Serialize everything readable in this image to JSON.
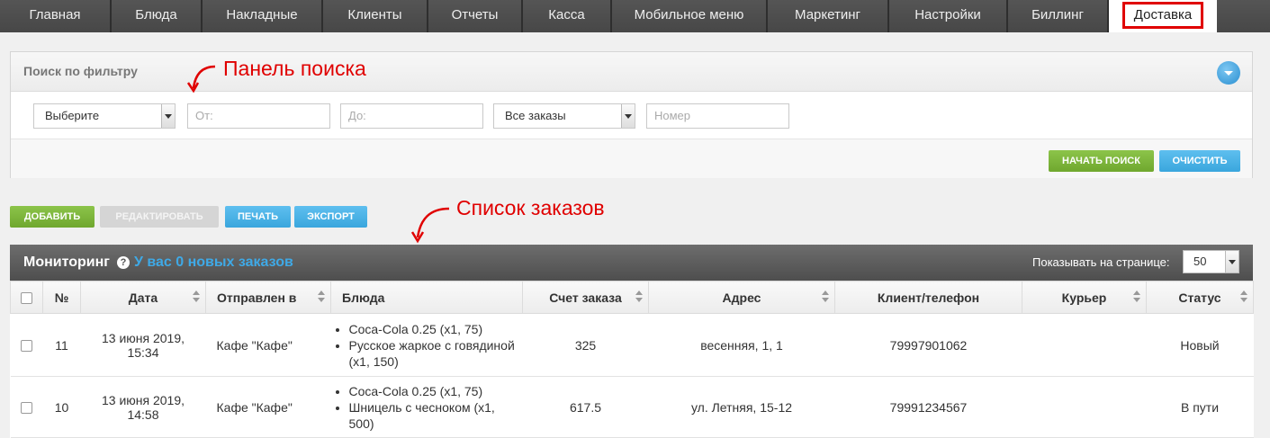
{
  "nav": {
    "tabs": [
      "Главная",
      "Блюда",
      "Накладные",
      "Клиенты",
      "Отчеты",
      "Касса",
      "Мобильное меню",
      "Маркетинг",
      "Настройки",
      "Биллинг",
      "Доставка"
    ],
    "active": "Доставка"
  },
  "search": {
    "title": "Поиск по фильтру",
    "select_1": "Выберите",
    "from_placeholder": "От:",
    "to_placeholder": "До:",
    "orders_select": "Все заказы",
    "number_placeholder": "Номер",
    "start_button": "НАЧАТЬ ПОИСК",
    "clear_button": "ОЧИСТИТЬ"
  },
  "annotations": {
    "search_panel": "Панель поиска",
    "orders_list": "Список заказов"
  },
  "toolbar": {
    "add": "ДОБАВИТЬ",
    "edit": "РЕДАКТИРОВАТЬ",
    "print": "ПЕЧАТЬ",
    "export": "ЭКСПОРТ"
  },
  "monitoring": {
    "title": "Мониторинг",
    "help": "?",
    "new_orders": "У вас 0 новых заказов",
    "per_page_label": "Показывать на странице:",
    "per_page_value": "50"
  },
  "table": {
    "columns": [
      "№",
      "Дата",
      "Отправлен в",
      "Блюда",
      "Счет заказа",
      "Адрес",
      "Клиент/телефон",
      "Курьер",
      "Статус"
    ],
    "rows": [
      {
        "id": "11",
        "date": "13 июня 2019,",
        "time": "15:34",
        "sent_to": "Кафе \"Кафе\"",
        "dishes": [
          "Coca-Cola 0.25 (x1, 75)",
          "Русское жаркое с говядиной (x1, 150)"
        ],
        "bill": "325",
        "address": "весенняя, 1, 1",
        "client": "79997901062",
        "courier": "",
        "status": "Новый"
      },
      {
        "id": "10",
        "date": "13 июня 2019,",
        "time": "14:58",
        "sent_to": "Кафе \"Кафе\"",
        "dishes": [
          "Coca-Cola 0.25 (x1, 75)",
          "Шницель с чесноком (x1, 500)"
        ],
        "bill": "617.5",
        "address": "ул. Летняя, 15-12",
        "client": "79991234567",
        "courier": "",
        "status": "В пути"
      }
    ]
  },
  "colors": {
    "accent_blue": "#3fa9e6",
    "accent_green": "#7ab63b",
    "annotation_red": "#e00000"
  }
}
